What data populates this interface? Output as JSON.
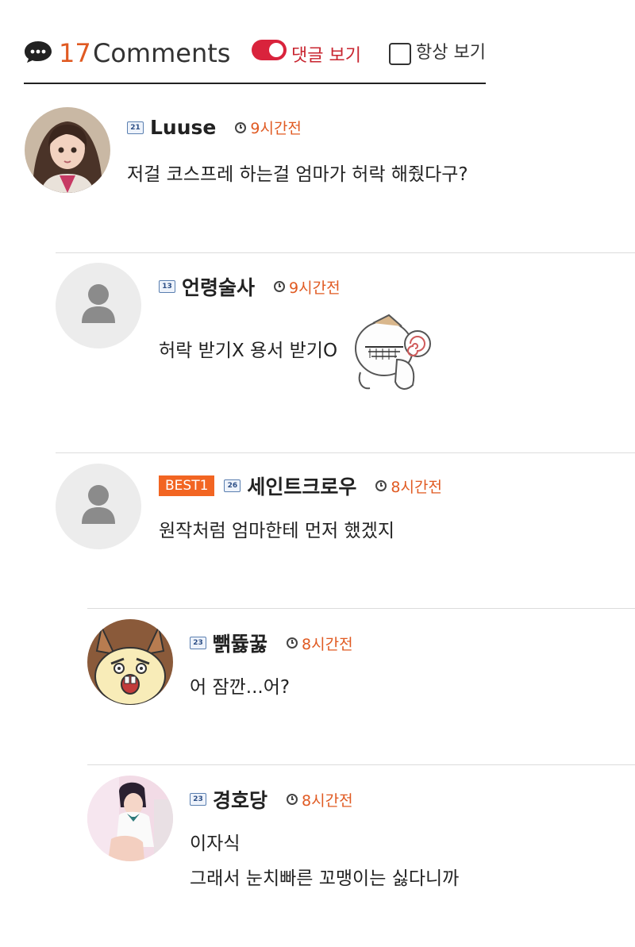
{
  "header": {
    "count": "17",
    "title": "Comments",
    "toggle_label": "댓글 보기",
    "always_label": "항상 보기",
    "accent_color": "#e05a22",
    "toggle_color": "#d9233c"
  },
  "comments": [
    {
      "level": "21",
      "name": "Luuse",
      "time": "9시간전",
      "text": [
        "저걸 코스프레 하는걸 엄마가 허락 해줬다구?"
      ],
      "avatar": "anime-girl-avatar"
    },
    {
      "level": "13",
      "name": "언령술사",
      "time": "9시간전",
      "text": [
        "허락 받기X 용서 받기O"
      ],
      "avatar": "default-avatar",
      "sticker": "dizzy-character-emoticon"
    },
    {
      "badge": "BEST1",
      "level": "26",
      "name": "세인트크로우",
      "time": "8시간전",
      "text": [
        "원작처럼 엄마한테 먼저 했겠지"
      ],
      "avatar": "default-avatar"
    },
    {
      "level": "23",
      "name": "뺅뜛꿇",
      "time": "8시간전",
      "text": [
        "어 잠깐...어?"
      ],
      "avatar": "cartoon-face-avatar"
    },
    {
      "level": "23",
      "name": "경호당",
      "time": "8시간전",
      "text": [
        "이자식",
        "그래서 눈치빠른 꼬맹이는 싫다니까"
      ],
      "avatar": "photo-avatar"
    }
  ]
}
